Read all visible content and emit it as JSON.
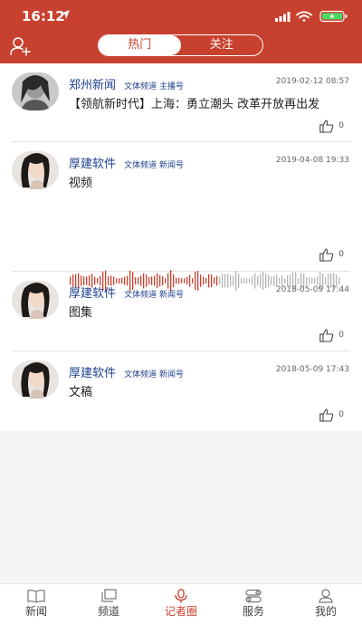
{
  "status": {
    "time": "16:12"
  },
  "header": {
    "tabs": [
      {
        "label": "热门",
        "active": true
      },
      {
        "label": "关注",
        "active": false
      }
    ]
  },
  "colors": {
    "brand": "#c8402e",
    "author": "#1d3f8c"
  },
  "posts": [
    {
      "author": "郑州新闻",
      "tags": "文体频道 主播号",
      "time": "2019-02-12 08:57",
      "content": "【领航新时代】上海：勇立潮头 改革开放再出发",
      "likes": "0",
      "avatar_style": "grayscale"
    },
    {
      "author": "厚建软件",
      "tags": "文体频道 新闻号",
      "time": "2019-04-08 19:33",
      "content": "视频",
      "likes": "0",
      "has_audio_wave": true
    },
    {
      "author": "厚建软件",
      "tags": "文体频道 新闻号",
      "time": "2018-05-09 17:44",
      "content": "图集",
      "likes": "0"
    },
    {
      "author": "厚建软件",
      "tags": "文体频道 新闻号",
      "time": "2018-05-09 17:43",
      "content": "文稿",
      "likes": "0"
    }
  ],
  "tabbar": [
    {
      "label": "新闻",
      "icon": "book-icon"
    },
    {
      "label": "频道",
      "icon": "layers-icon"
    },
    {
      "label": "记者圈",
      "icon": "microphone-icon",
      "active": true
    },
    {
      "label": "服务",
      "icon": "toggle-icon"
    },
    {
      "label": "我的",
      "icon": "user-icon"
    }
  ]
}
